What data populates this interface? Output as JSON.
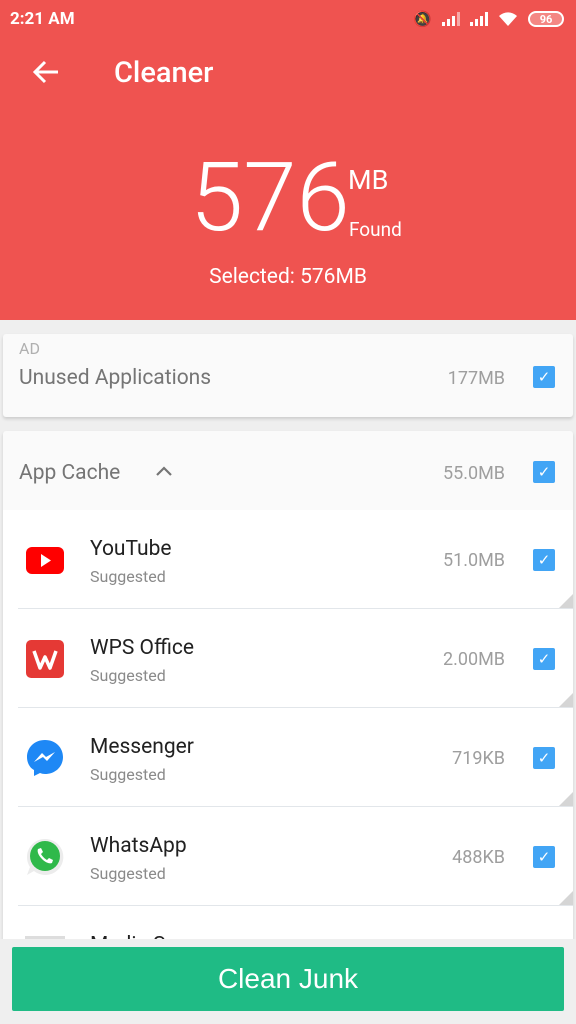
{
  "status_bar": {
    "time": "2:21 AM",
    "battery": "96"
  },
  "header": {
    "title": "Cleaner",
    "found_amount": "576",
    "found_unit": "MB",
    "found_label": "Found",
    "selected_text": "Selected: 576MB"
  },
  "ad_section": {
    "tag": "AD",
    "label": "Unused Applications",
    "size": "177MB",
    "checked": true
  },
  "cache_section": {
    "label": "App Cache",
    "size": "55.0MB",
    "checked": true,
    "expanded": true,
    "items": [
      {
        "name": "YouTube",
        "sub": "Suggested",
        "size": "51.0MB",
        "checked": true,
        "icon": "youtube-icon"
      },
      {
        "name": "WPS Office",
        "sub": "Suggested",
        "size": "2.00MB",
        "checked": true,
        "icon": "wps-office-icon"
      },
      {
        "name": "Messenger",
        "sub": "Suggested",
        "size": "719KB",
        "checked": true,
        "icon": "messenger-icon"
      },
      {
        "name": "WhatsApp",
        "sub": "Suggested",
        "size": "488KB",
        "checked": true,
        "icon": "whatsapp-icon"
      },
      {
        "name": "Media S",
        "sub": "",
        "size": "",
        "checked": true,
        "icon": "media-storage-icon"
      }
    ]
  },
  "actions": {
    "clean_label": "Clean Junk"
  },
  "colors": {
    "header_bg": "#ef5350",
    "checkbox": "#42a5f5",
    "clean_button": "#1fbb85"
  }
}
